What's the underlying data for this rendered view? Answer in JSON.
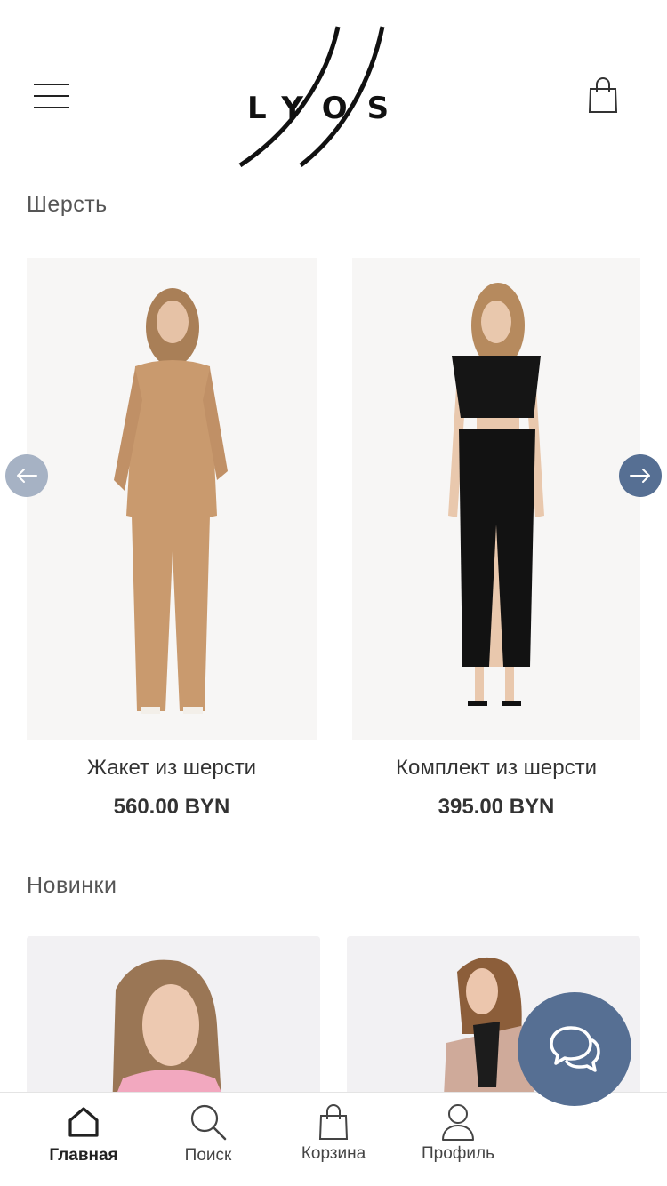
{
  "header": {
    "logo_text": "LYOS",
    "menu_icon": "hamburger-menu-icon",
    "cart_icon": "shopping-bag-icon"
  },
  "sections": [
    {
      "title": "Шерсть",
      "products": [
        {
          "name": "Жакет из шерсти",
          "price": "560.00 BYN"
        },
        {
          "name": "Комплект из шерсти",
          "price": "395.00 BYN"
        }
      ]
    },
    {
      "title": "Новинки"
    }
  ],
  "carousel": {
    "prev_icon": "arrow-left-icon",
    "next_icon": "arrow-right-icon"
  },
  "chat": {
    "icon": "chat-bubbles-icon"
  },
  "bottom_nav": {
    "items": [
      {
        "label": "Главная",
        "icon": "home-icon",
        "active": true
      },
      {
        "label": "Поиск",
        "icon": "search-icon",
        "active": false
      },
      {
        "label": "Корзина",
        "icon": "shopping-bag-icon",
        "active": false
      },
      {
        "label": "Профиль",
        "icon": "user-icon",
        "active": false
      }
    ]
  },
  "colors": {
    "accent": "#566f93",
    "accent_light": "#a6b2c4",
    "text": "#333333"
  }
}
